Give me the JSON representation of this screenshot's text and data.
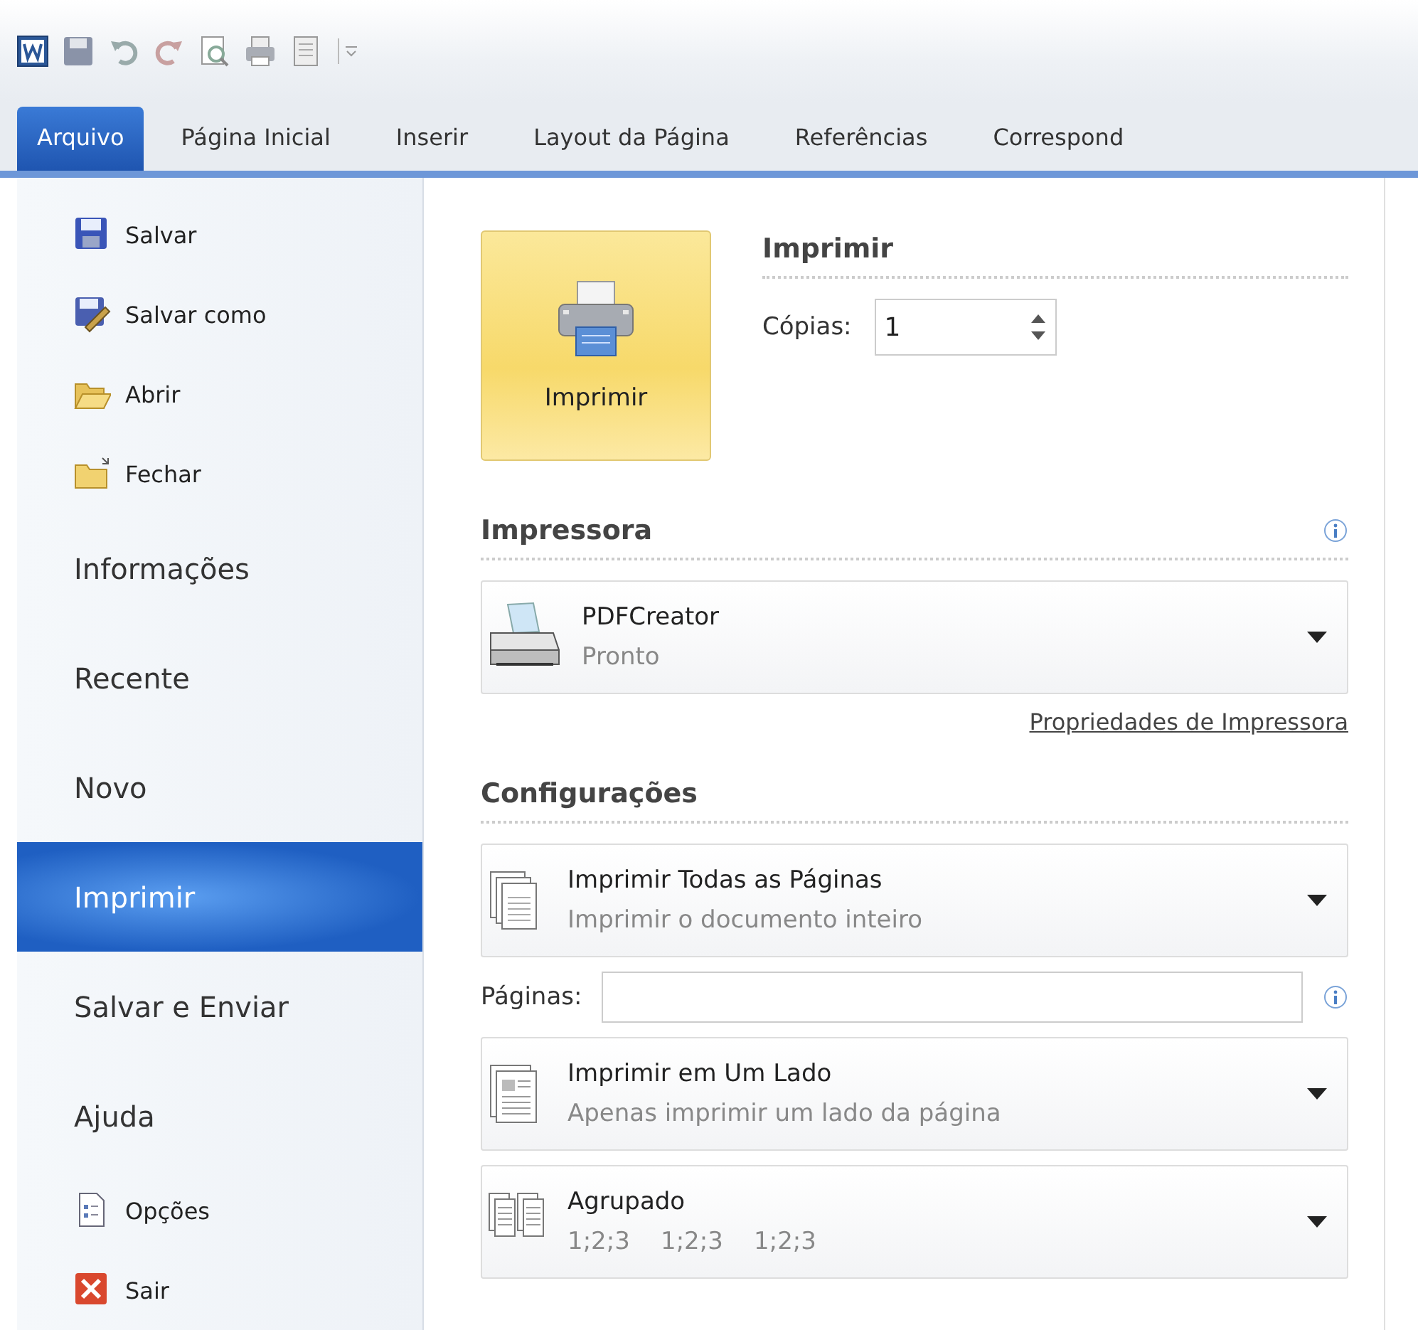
{
  "tabs": [
    {
      "label": "Arquivo",
      "selected": true
    },
    {
      "label": "Página Inicial",
      "selected": false
    },
    {
      "label": "Inserir",
      "selected": false
    },
    {
      "label": "Layout da Página",
      "selected": false
    },
    {
      "label": "Referências",
      "selected": false
    },
    {
      "label": "Correspond",
      "selected": false
    }
  ],
  "sidebar": {
    "items": [
      {
        "kind": "command",
        "label": "Salvar",
        "selected": false
      },
      {
        "kind": "command",
        "label": "Salvar como",
        "selected": false
      },
      {
        "kind": "command",
        "label": "Abrir",
        "selected": false
      },
      {
        "kind": "command",
        "label": "Fechar",
        "selected": false
      },
      {
        "kind": "page",
        "label": "Informações",
        "selected": false
      },
      {
        "kind": "page",
        "label": "Recente",
        "selected": false
      },
      {
        "kind": "page",
        "label": "Novo",
        "selected": false
      },
      {
        "kind": "page",
        "label": "Imprimir",
        "selected": true
      },
      {
        "kind": "page",
        "label": "Salvar e Enviar",
        "selected": false
      },
      {
        "kind": "page",
        "label": "Ajuda",
        "selected": false
      },
      {
        "kind": "command",
        "label": "Opções",
        "selected": false
      },
      {
        "kind": "command",
        "label": "Sair",
        "selected": false
      }
    ]
  },
  "print": {
    "button": "Imprimir",
    "heading": "Imprimir",
    "copies_label": "Cópias:",
    "copies_value": "1"
  },
  "printer": {
    "heading": "Impressora",
    "name": "PDFCreator",
    "status": "Pronto",
    "properties_link": "Propriedades de Impressora"
  },
  "settings": {
    "heading": "Configurações",
    "dropdowns": [
      {
        "kind": "dropdown",
        "title": "Imprimir Todas as Páginas",
        "subtitle": "Imprimir o documento inteiro"
      },
      {
        "kind": "pages_field",
        "label": "Páginas:"
      },
      {
        "kind": "dropdown",
        "title": "Imprimir em Um Lado",
        "subtitle": "Apenas imprimir um lado da página"
      },
      {
        "kind": "dropdown",
        "title": "Agrupado",
        "subtitle": "1;2;3    1;2;3    1;2;3"
      }
    ]
  }
}
